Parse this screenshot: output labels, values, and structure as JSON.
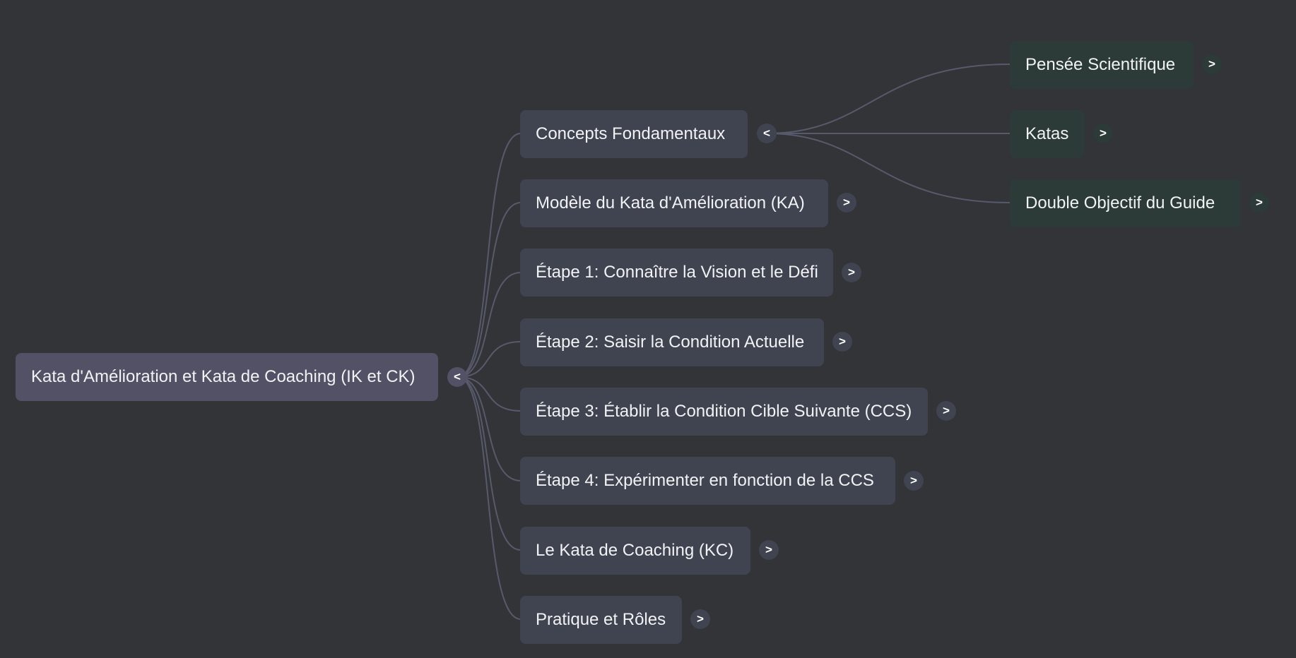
{
  "mindmap": {
    "root": {
      "label": "Kata d'Amélioration et Kata de Coaching (IK et CK)",
      "toggle": "<"
    },
    "branches": [
      {
        "label": "Concepts Fondamentaux",
        "toggle": "<",
        "children": [
          {
            "label": "Pensée Scientifique",
            "toggle": ">"
          },
          {
            "label": "Katas",
            "toggle": ">"
          },
          {
            "label": "Double Objectif du Guide",
            "toggle": ">"
          }
        ]
      },
      {
        "label": "Modèle du Kata d'Amélioration (KA)",
        "toggle": ">"
      },
      {
        "label": "Étape 1: Connaître la Vision et le Défi",
        "toggle": ">"
      },
      {
        "label": "Étape 2: Saisir la Condition Actuelle",
        "toggle": ">"
      },
      {
        "label": "Étape 3: Établir la Condition Cible Suivante (CCS)",
        "toggle": ">"
      },
      {
        "label": "Étape 4: Expérimenter en fonction de la CCS",
        "toggle": ">"
      },
      {
        "label": "Le Kata de Coaching (KC)",
        "toggle": ">"
      },
      {
        "label": "Pratique et Rôles",
        "toggle": ">"
      }
    ]
  },
  "colors": {
    "background": "#323438",
    "root_node": "#535165",
    "branch_node": "#404451",
    "leaf_node": "#2c3b37",
    "connector": "#575a6b",
    "text": "#f1f2f4"
  }
}
